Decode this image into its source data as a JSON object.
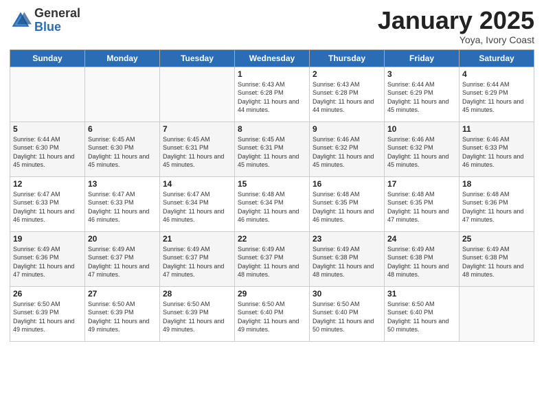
{
  "logo": {
    "general": "General",
    "blue": "Blue"
  },
  "header": {
    "month": "January 2025",
    "location": "Yoya, Ivory Coast"
  },
  "days_of_week": [
    "Sunday",
    "Monday",
    "Tuesday",
    "Wednesday",
    "Thursday",
    "Friday",
    "Saturday"
  ],
  "weeks": [
    [
      {
        "num": "",
        "sunrise": "",
        "sunset": "",
        "daylight": ""
      },
      {
        "num": "",
        "sunrise": "",
        "sunset": "",
        "daylight": ""
      },
      {
        "num": "",
        "sunrise": "",
        "sunset": "",
        "daylight": ""
      },
      {
        "num": "1",
        "sunrise": "Sunrise: 6:43 AM",
        "sunset": "Sunset: 6:28 PM",
        "daylight": "Daylight: 11 hours and 44 minutes."
      },
      {
        "num": "2",
        "sunrise": "Sunrise: 6:43 AM",
        "sunset": "Sunset: 6:28 PM",
        "daylight": "Daylight: 11 hours and 44 minutes."
      },
      {
        "num": "3",
        "sunrise": "Sunrise: 6:44 AM",
        "sunset": "Sunset: 6:29 PM",
        "daylight": "Daylight: 11 hours and 45 minutes."
      },
      {
        "num": "4",
        "sunrise": "Sunrise: 6:44 AM",
        "sunset": "Sunset: 6:29 PM",
        "daylight": "Daylight: 11 hours and 45 minutes."
      }
    ],
    [
      {
        "num": "5",
        "sunrise": "Sunrise: 6:44 AM",
        "sunset": "Sunset: 6:30 PM",
        "daylight": "Daylight: 11 hours and 45 minutes."
      },
      {
        "num": "6",
        "sunrise": "Sunrise: 6:45 AM",
        "sunset": "Sunset: 6:30 PM",
        "daylight": "Daylight: 11 hours and 45 minutes."
      },
      {
        "num": "7",
        "sunrise": "Sunrise: 6:45 AM",
        "sunset": "Sunset: 6:31 PM",
        "daylight": "Daylight: 11 hours and 45 minutes."
      },
      {
        "num": "8",
        "sunrise": "Sunrise: 6:45 AM",
        "sunset": "Sunset: 6:31 PM",
        "daylight": "Daylight: 11 hours and 45 minutes."
      },
      {
        "num": "9",
        "sunrise": "Sunrise: 6:46 AM",
        "sunset": "Sunset: 6:32 PM",
        "daylight": "Daylight: 11 hours and 45 minutes."
      },
      {
        "num": "10",
        "sunrise": "Sunrise: 6:46 AM",
        "sunset": "Sunset: 6:32 PM",
        "daylight": "Daylight: 11 hours and 45 minutes."
      },
      {
        "num": "11",
        "sunrise": "Sunrise: 6:46 AM",
        "sunset": "Sunset: 6:33 PM",
        "daylight": "Daylight: 11 hours and 46 minutes."
      }
    ],
    [
      {
        "num": "12",
        "sunrise": "Sunrise: 6:47 AM",
        "sunset": "Sunset: 6:33 PM",
        "daylight": "Daylight: 11 hours and 46 minutes."
      },
      {
        "num": "13",
        "sunrise": "Sunrise: 6:47 AM",
        "sunset": "Sunset: 6:33 PM",
        "daylight": "Daylight: 11 hours and 46 minutes."
      },
      {
        "num": "14",
        "sunrise": "Sunrise: 6:47 AM",
        "sunset": "Sunset: 6:34 PM",
        "daylight": "Daylight: 11 hours and 46 minutes."
      },
      {
        "num": "15",
        "sunrise": "Sunrise: 6:48 AM",
        "sunset": "Sunset: 6:34 PM",
        "daylight": "Daylight: 11 hours and 46 minutes."
      },
      {
        "num": "16",
        "sunrise": "Sunrise: 6:48 AM",
        "sunset": "Sunset: 6:35 PM",
        "daylight": "Daylight: 11 hours and 46 minutes."
      },
      {
        "num": "17",
        "sunrise": "Sunrise: 6:48 AM",
        "sunset": "Sunset: 6:35 PM",
        "daylight": "Daylight: 11 hours and 47 minutes."
      },
      {
        "num": "18",
        "sunrise": "Sunrise: 6:48 AM",
        "sunset": "Sunset: 6:36 PM",
        "daylight": "Daylight: 11 hours and 47 minutes."
      }
    ],
    [
      {
        "num": "19",
        "sunrise": "Sunrise: 6:49 AM",
        "sunset": "Sunset: 6:36 PM",
        "daylight": "Daylight: 11 hours and 47 minutes."
      },
      {
        "num": "20",
        "sunrise": "Sunrise: 6:49 AM",
        "sunset": "Sunset: 6:37 PM",
        "daylight": "Daylight: 11 hours and 47 minutes."
      },
      {
        "num": "21",
        "sunrise": "Sunrise: 6:49 AM",
        "sunset": "Sunset: 6:37 PM",
        "daylight": "Daylight: 11 hours and 47 minutes."
      },
      {
        "num": "22",
        "sunrise": "Sunrise: 6:49 AM",
        "sunset": "Sunset: 6:37 PM",
        "daylight": "Daylight: 11 hours and 48 minutes."
      },
      {
        "num": "23",
        "sunrise": "Sunrise: 6:49 AM",
        "sunset": "Sunset: 6:38 PM",
        "daylight": "Daylight: 11 hours and 48 minutes."
      },
      {
        "num": "24",
        "sunrise": "Sunrise: 6:49 AM",
        "sunset": "Sunset: 6:38 PM",
        "daylight": "Daylight: 11 hours and 48 minutes."
      },
      {
        "num": "25",
        "sunrise": "Sunrise: 6:49 AM",
        "sunset": "Sunset: 6:38 PM",
        "daylight": "Daylight: 11 hours and 48 minutes."
      }
    ],
    [
      {
        "num": "26",
        "sunrise": "Sunrise: 6:50 AM",
        "sunset": "Sunset: 6:39 PM",
        "daylight": "Daylight: 11 hours and 49 minutes."
      },
      {
        "num": "27",
        "sunrise": "Sunrise: 6:50 AM",
        "sunset": "Sunset: 6:39 PM",
        "daylight": "Daylight: 11 hours and 49 minutes."
      },
      {
        "num": "28",
        "sunrise": "Sunrise: 6:50 AM",
        "sunset": "Sunset: 6:39 PM",
        "daylight": "Daylight: 11 hours and 49 minutes."
      },
      {
        "num": "29",
        "sunrise": "Sunrise: 6:50 AM",
        "sunset": "Sunset: 6:40 PM",
        "daylight": "Daylight: 11 hours and 49 minutes."
      },
      {
        "num": "30",
        "sunrise": "Sunrise: 6:50 AM",
        "sunset": "Sunset: 6:40 PM",
        "daylight": "Daylight: 11 hours and 50 minutes."
      },
      {
        "num": "31",
        "sunrise": "Sunrise: 6:50 AM",
        "sunset": "Sunset: 6:40 PM",
        "daylight": "Daylight: 11 hours and 50 minutes."
      },
      {
        "num": "",
        "sunrise": "",
        "sunset": "",
        "daylight": ""
      }
    ]
  ]
}
